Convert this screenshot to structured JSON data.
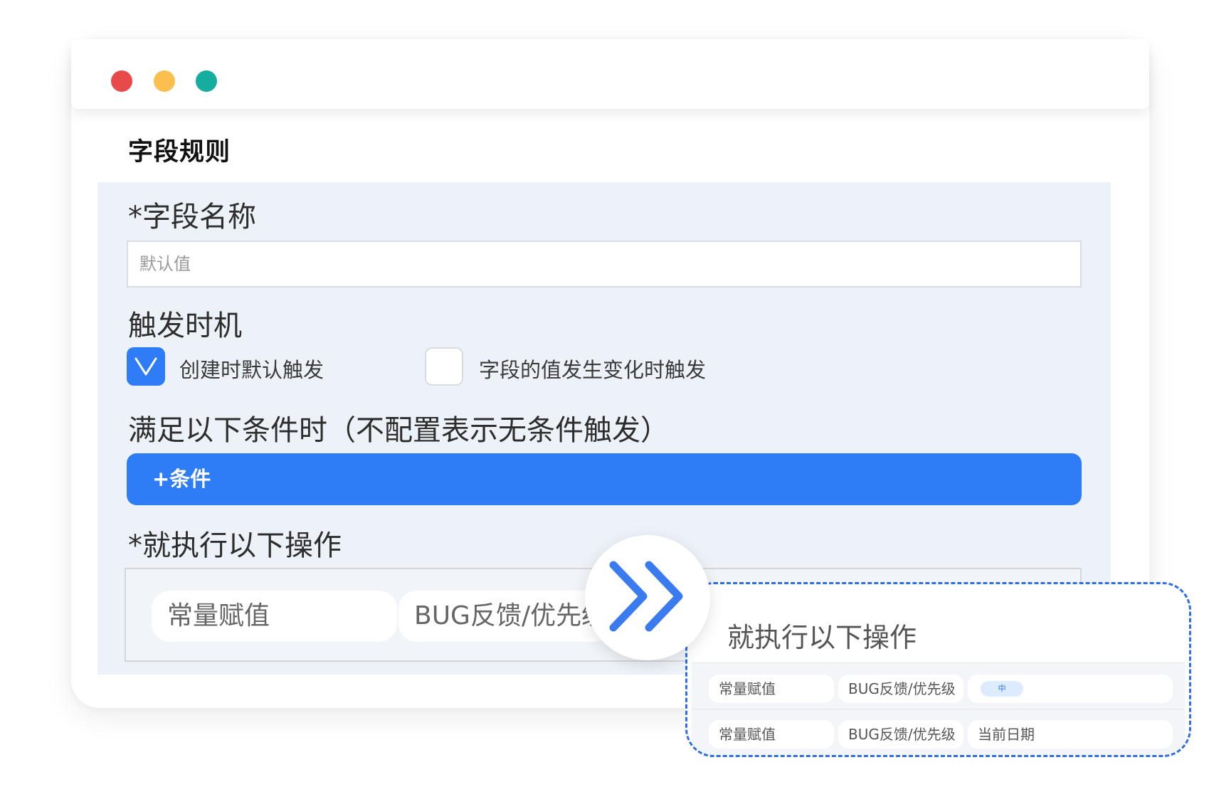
{
  "window": {
    "controls": [
      {
        "name": "close",
        "color": "#e84a4a"
      },
      {
        "name": "minimize",
        "color": "#fbbf4f"
      },
      {
        "name": "maximize",
        "color": "#14ad9e"
      }
    ]
  },
  "page_title": "字段规则",
  "form": {
    "field_name": {
      "label": "*字段名称",
      "placeholder": "默认值"
    },
    "trigger": {
      "label": "触发时机",
      "options": [
        {
          "label": "创建时默认触发",
          "checked": true
        },
        {
          "label": "字段的值发生变化时触发",
          "checked": false
        }
      ]
    },
    "conditions": {
      "label": "满足以下条件时（不配置表示无条件触发）",
      "add_button": "+条件"
    },
    "actions": {
      "label": "*就执行以下操作",
      "row": [
        "常量赋值",
        "BUG反馈/优先级"
      ]
    }
  },
  "popup": {
    "title": "就执行以下操作",
    "rows": [
      {
        "type": "常量赋值",
        "field": "BUG反馈/优先级",
        "value_tag": "中"
      },
      {
        "type": "常量赋值",
        "field": "BUG反馈/优先级",
        "value": "当前日期"
      }
    ]
  },
  "colors": {
    "accent": "#2f7df6",
    "panel_bg": "#edf2f9",
    "popup_border": "#2f6fe0"
  },
  "icons": {
    "expand": "double-chevron-right-icon",
    "check": "check-icon"
  }
}
